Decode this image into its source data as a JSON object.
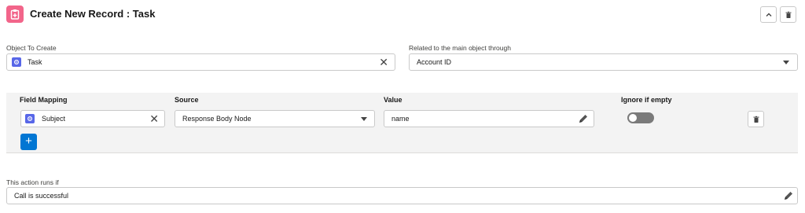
{
  "header": {
    "title": "Create New Record : Task",
    "icon": "clipboard-icon",
    "collapse_icon": "chevron-up-icon",
    "delete_icon": "trash-icon"
  },
  "object_field": {
    "label": "Object To Create",
    "value": "Task",
    "icon": "object-icon"
  },
  "related_field": {
    "label": "Related to the main object through",
    "value": "Account ID"
  },
  "mapping_table": {
    "headers": {
      "field_mapping": "Field Mapping",
      "source": "Source",
      "value": "Value",
      "ignore_if_empty": "Ignore if empty"
    },
    "rows": [
      {
        "field": "Subject",
        "source": "Response Body Node",
        "value": "name",
        "ignore_if_empty": false
      }
    ],
    "add_label": "+"
  },
  "condition": {
    "label": "This action runs if",
    "value": "Call is successful"
  },
  "colors": {
    "header_icon_bg": "#f2658a",
    "object_icon_bg": "#5867e8",
    "add_button_bg": "#0176d3",
    "toggle_off": "#7a7a7a",
    "table_bg": "#f3f3f3"
  }
}
